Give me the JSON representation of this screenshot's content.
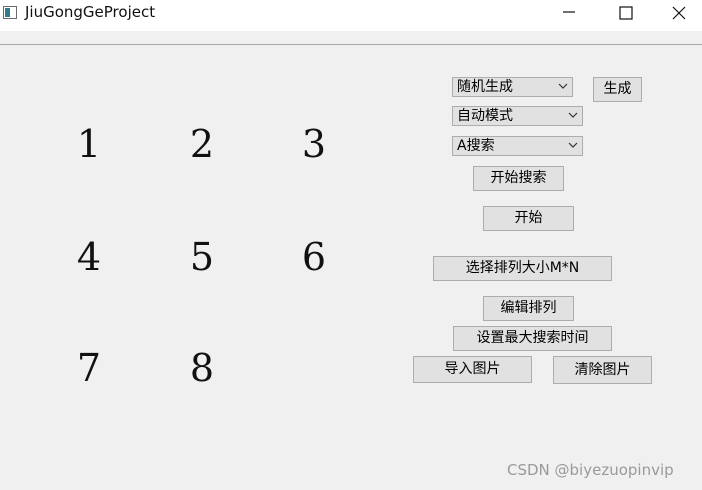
{
  "window": {
    "title": "JiuGongGeProject",
    "controls": {
      "minimize": "minimize",
      "maximize": "maximize",
      "close": "close"
    }
  },
  "board": {
    "tiles": [
      "1",
      "2",
      "3",
      "4",
      "5",
      "6",
      "7",
      "8",
      ""
    ]
  },
  "controls": {
    "generation_mode_select": {
      "value": "随机生成"
    },
    "generate_button": "生成",
    "mode_select": {
      "value": "自动模式"
    },
    "algorithm_select": {
      "value": "A搜索"
    },
    "start_search_button": "开始搜索",
    "start_button": "开始",
    "choose_size_button": "选择排列大小M*N",
    "edit_arrangement_button": "编辑排列",
    "set_max_time_button": "设置最大搜索时间",
    "import_image_button": "导入图片",
    "clear_image_button": "清除图片"
  },
  "watermark": "CSDN @biyezuopinvip"
}
